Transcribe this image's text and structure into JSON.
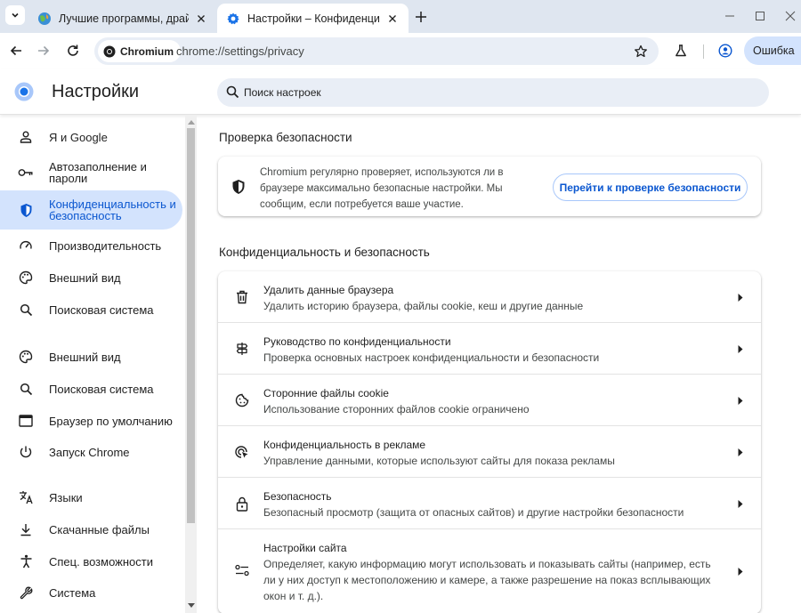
{
  "tabs": [
    {
      "title": "Лучшие программы, драйвер",
      "active": false,
      "favicon": "globe-icon"
    },
    {
      "title": "Настройки – Конфиденциальн",
      "active": true,
      "favicon": "gear-icon"
    }
  ],
  "toolbar": {
    "chip_label": "Chromium",
    "url": "chrome://settings/privacy",
    "profile_error_label": "Ошибка"
  },
  "header": {
    "title": "Настройки",
    "search_placeholder": "Поиск настроек"
  },
  "sidebar": {
    "items": [
      {
        "label": "Я и Google",
        "icon": "person-icon"
      },
      {
        "label": "Автозаполнение и пароли",
        "icon": "key-icon"
      },
      {
        "label": "Конфиденциальность и безопасность",
        "icon": "shield-icon",
        "active": true
      },
      {
        "label": "Производительность",
        "icon": "speedometer-icon"
      },
      {
        "label": "Внешний вид",
        "icon": "palette-icon"
      },
      {
        "label": "Поисковая система",
        "icon": "search-icon"
      },
      {
        "label": "Внешний вид",
        "icon": "palette-icon"
      },
      {
        "label": "Поисковая система",
        "icon": "search-icon"
      },
      {
        "label": "Браузер по умолчанию",
        "icon": "browser-window-icon"
      },
      {
        "label": "Запуск Chrome",
        "icon": "power-icon"
      },
      {
        "label": "Языки",
        "icon": "translate-icon"
      },
      {
        "label": "Скачанные файлы",
        "icon": "download-icon"
      },
      {
        "label": "Спец. возможности",
        "icon": "accessibility-icon"
      },
      {
        "label": "Система",
        "icon": "wrench-icon"
      }
    ]
  },
  "safety_check": {
    "section_title": "Проверка безопасности",
    "description": "Chromium регулярно проверяет, используются ли в браузере максимально безопасные настройки. Мы сообщим, если потребуется ваше участие.",
    "button_label": "Перейти к проверке безопасности"
  },
  "privacy": {
    "section_title": "Конфиденциальность и безопасность",
    "rows": [
      {
        "title": "Удалить данные браузера",
        "subtitle": "Удалить историю браузера, файлы cookie, кеш и другие данные",
        "icon": "trash-icon"
      },
      {
        "title": "Руководство по конфиденциальности",
        "subtitle": "Проверка основных настроек конфиденциальности и безопасности",
        "icon": "signpost-icon"
      },
      {
        "title": "Сторонние файлы cookie",
        "subtitle": "Использование сторонних файлов cookie ограничено",
        "icon": "cookie-icon"
      },
      {
        "title": "Конфиденциальность в рекламе",
        "subtitle": "Управление данными, которые используют сайты для показа рекламы",
        "icon": "ad-privacy-icon"
      },
      {
        "title": "Безопасность",
        "subtitle": "Безопасный просмотр (защита от опасных сайтов) и другие настройки безопасности",
        "icon": "lock-icon"
      },
      {
        "title": "Настройки сайта",
        "subtitle": "Определяет, какую информацию могут использовать и показывать сайты (например, есть ли у них доступ к местоположению и камере, а также разрешение на показ всплывающих окон и т. д.).",
        "icon": "sliders-icon"
      }
    ]
  },
  "colors": {
    "accent": "#0b57d0",
    "active_nav_bg": "#d3e3fd",
    "tabstrip_bg": "#dfe6f0",
    "omnibox_bg": "#e9eef6"
  }
}
